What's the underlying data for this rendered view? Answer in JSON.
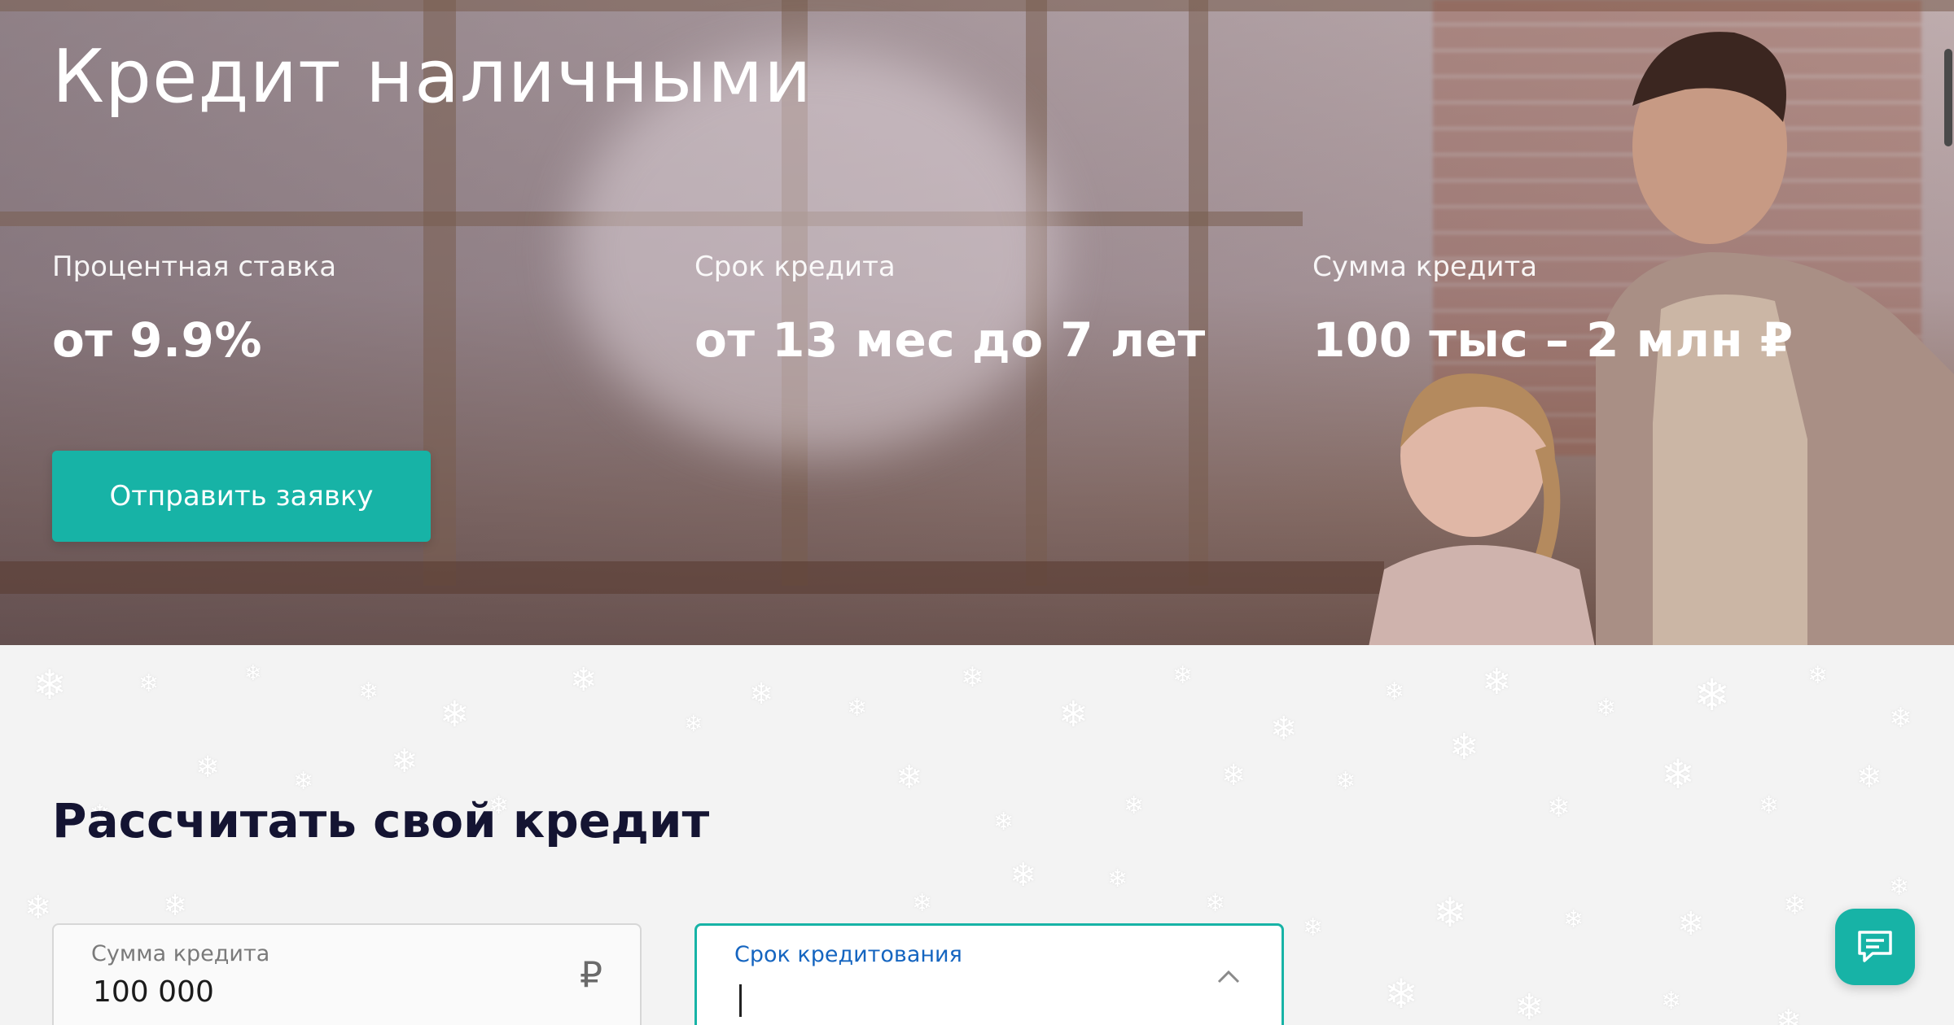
{
  "hero": {
    "title": "Кредит наличными",
    "stats": [
      {
        "label": "Процентная ставка",
        "value": "от 9.9%"
      },
      {
        "label": "Срок кредита",
        "value": "от 13 мес до 7 лет"
      },
      {
        "label": "Сумма кредита",
        "value": "100 тыс – 2 млн ₽"
      }
    ],
    "cta_label": "Отправить заявку"
  },
  "calculator": {
    "title": "Рассчитать свой кредит",
    "amount": {
      "label": "Сумма кредита",
      "value": "100 000",
      "currency": "₽",
      "slider_fraction": 0.0
    },
    "term": {
      "label": "Срок кредитования",
      "value": ""
    }
  },
  "icons": {
    "chevron": "chevron-up-icon",
    "chat": "chat-icon",
    "snowflake": "snowflake-icon"
  },
  "colors": {
    "accent": "#17b3a6",
    "title": "#141432",
    "term_label": "#1565c0"
  }
}
